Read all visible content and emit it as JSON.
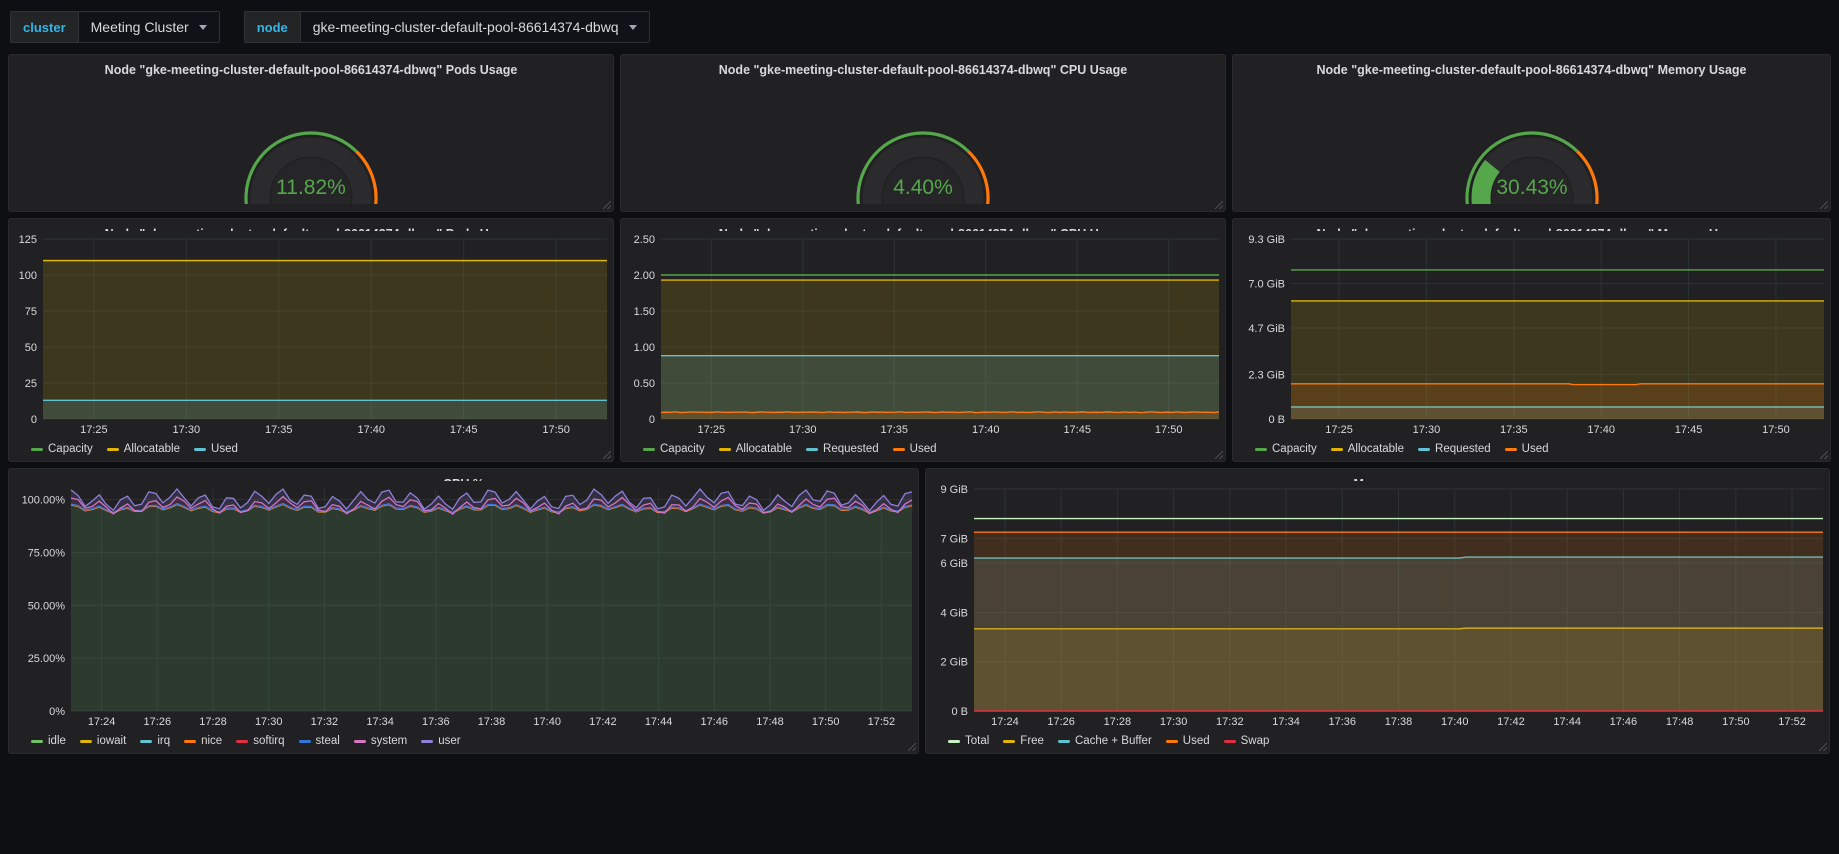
{
  "variables": [
    {
      "name": "cluster",
      "label": "cluster",
      "value": "Meeting Cluster"
    },
    {
      "name": "node",
      "label": "node",
      "value": "gke-meeting-cluster-default-pool-86614374-dbwq"
    }
  ],
  "node_name": "gke-meeting-cluster-default-pool-86614374-dbwq",
  "colors": {
    "green": "#56a64b",
    "yellow": "#e0b400",
    "orange": "#ff780a",
    "red": "#e02f44",
    "blue": "#5794f2",
    "lightblue": "#5fc3d4",
    "purple": "#8f7fd9",
    "magenta": "#d973c4",
    "panel_bg": "#212124",
    "page_bg": "#0e0f12",
    "grid": "#2c3235",
    "text": "#d8d9da"
  },
  "gauges": [
    {
      "title": "Node \"gke-meeting-cluster-default-pool-86614374-dbwq\" Pods Usage",
      "value": "11.82%",
      "percent": 11.82
    },
    {
      "title": "Node \"gke-meeting-cluster-default-pool-86614374-dbwq\" CPU Usage",
      "value": "4.40%",
      "percent": 4.4
    },
    {
      "title": "Node \"gke-meeting-cluster-default-pool-86614374-dbwq\" Memory Usage",
      "value": "30.43%",
      "percent": 30.43
    }
  ],
  "chart_data": [
    {
      "id": "pods_usage",
      "type": "line",
      "title": "Node \"gke-meeting-cluster-default-pool-86614374-dbwq\" Pods Usage",
      "xlabel": "",
      "ylabel": "",
      "ylim": [
        0,
        125
      ],
      "yticks": [
        "0",
        "25",
        "50",
        "75",
        "100",
        "125"
      ],
      "ytick_values": [
        0,
        25,
        50,
        75,
        100,
        125
      ],
      "xticks": [
        "17:25",
        "17:30",
        "17:35",
        "17:40",
        "17:45",
        "17:50"
      ],
      "grid": true,
      "legend": "bottom",
      "series": [
        {
          "name": "Capacity",
          "color": "#56a64b",
          "value": 110,
          "fill": false
        },
        {
          "name": "Allocatable",
          "color": "#e0b400",
          "value": 110,
          "fill": true
        },
        {
          "name": "Used",
          "color": "#5fc3d4",
          "value": 13,
          "fill": true
        }
      ]
    },
    {
      "id": "cpu_usage",
      "type": "line",
      "title": "Node \"gke-meeting-cluster-default-pool-86614374-dbwq\" CPU Usage",
      "xlabel": "",
      "ylabel": "",
      "ylim": [
        0,
        2.5
      ],
      "yticks": [
        "0",
        "0.50",
        "1.00",
        "1.50",
        "2.00",
        "2.50"
      ],
      "ytick_values": [
        0,
        0.5,
        1.0,
        1.5,
        2.0,
        2.5
      ],
      "xticks": [
        "17:25",
        "17:30",
        "17:35",
        "17:40",
        "17:45",
        "17:50"
      ],
      "grid": true,
      "legend": "bottom",
      "series": [
        {
          "name": "Capacity",
          "color": "#56a64b",
          "value": 2.0,
          "fill": false
        },
        {
          "name": "Allocatable",
          "color": "#e0b400",
          "value": 1.93,
          "fill": true
        },
        {
          "name": "Requested",
          "color": "#5fc3d4",
          "value": 0.88,
          "fill": true
        },
        {
          "name": "Used",
          "color": "#ff780a",
          "value": 0.09,
          "fill": true
        }
      ]
    },
    {
      "id": "memory_usage",
      "type": "line",
      "title": "Node \"gke-meeting-cluster-default-pool-86614374-dbwq\" Memory Usage",
      "xlabel": "",
      "ylabel": "",
      "ylim": [
        0,
        9.3
      ],
      "yticks": [
        "0 B",
        "2.3 GiB",
        "4.7 GiB",
        "7.0 GiB",
        "9.3 GiB"
      ],
      "ytick_values": [
        0,
        2.3,
        4.7,
        7.0,
        9.3
      ],
      "xticks": [
        "17:25",
        "17:30",
        "17:35",
        "17:40",
        "17:45",
        "17:50"
      ],
      "grid": true,
      "legend": "bottom",
      "series": [
        {
          "name": "Capacity",
          "color": "#56a64b",
          "value": 7.7,
          "fill": false
        },
        {
          "name": "Allocatable",
          "color": "#e0b400",
          "value": 6.1,
          "fill": true
        },
        {
          "name": "Requested",
          "color": "#5fc3d4",
          "value": 0.62,
          "fill": true
        },
        {
          "name": "Used",
          "color": "#ff780a",
          "value": 1.82,
          "fill": true
        }
      ]
    },
    {
      "id": "cpu_percent",
      "type": "area",
      "title": "CPU %",
      "xlabel": "",
      "ylabel": "",
      "ylim": [
        0,
        105
      ],
      "yticks": [
        "0%",
        "25.00%",
        "50.00%",
        "75.00%",
        "100.00%"
      ],
      "ytick_values": [
        0,
        25,
        50,
        75,
        100
      ],
      "xticks": [
        "17:24",
        "17:26",
        "17:28",
        "17:30",
        "17:32",
        "17:34",
        "17:36",
        "17:38",
        "17:40",
        "17:42",
        "17:44",
        "17:46",
        "17:48",
        "17:50",
        "17:52"
      ],
      "grid": true,
      "legend": "bottom",
      "stacked": true,
      "series": [
        {
          "name": "idle",
          "color": "#73bf69",
          "value": 95.6
        },
        {
          "name": "iowait",
          "color": "#e0b400",
          "value": 0.1
        },
        {
          "name": "irq",
          "color": "#5fc3d4",
          "value": 0.0
        },
        {
          "name": "nice",
          "color": "#ff780a",
          "value": 0.0
        },
        {
          "name": "softirq",
          "color": "#e02f44",
          "value": 0.2
        },
        {
          "name": "steal",
          "color": "#3274d9",
          "value": 0.1
        },
        {
          "name": "system",
          "color": "#d973c4",
          "value": 1.2
        },
        {
          "name": "user",
          "color": "#8f7fd9",
          "value": 2.8
        }
      ]
    },
    {
      "id": "memory",
      "type": "area",
      "title": "Memory",
      "xlabel": "",
      "ylabel": "",
      "ylim": [
        0,
        9
      ],
      "yticks": [
        "0 B",
        "2 GiB",
        "4 GiB",
        "6 GiB",
        "7 GiB",
        "9 GiB"
      ],
      "ytick_values": [
        0,
        2,
        4,
        6,
        7,
        9
      ],
      "xticks": [
        "17:24",
        "17:26",
        "17:28",
        "17:30",
        "17:32",
        "17:34",
        "17:36",
        "17:38",
        "17:40",
        "17:42",
        "17:44",
        "17:46",
        "17:48",
        "17:50",
        "17:52"
      ],
      "grid": true,
      "legend": "bottom",
      "series": [
        {
          "name": "Total",
          "color": "#c8f2c2",
          "value": 7.8
        },
        {
          "name": "Free",
          "color": "#e0b400",
          "value": 3.33
        },
        {
          "name": "Cache + Buffer",
          "color": "#5fc3d4",
          "value": 6.2
        },
        {
          "name": "Used",
          "color": "#ff780a",
          "value": 7.25
        },
        {
          "name": "Swap",
          "color": "#e02f44",
          "value": 0
        }
      ]
    }
  ]
}
